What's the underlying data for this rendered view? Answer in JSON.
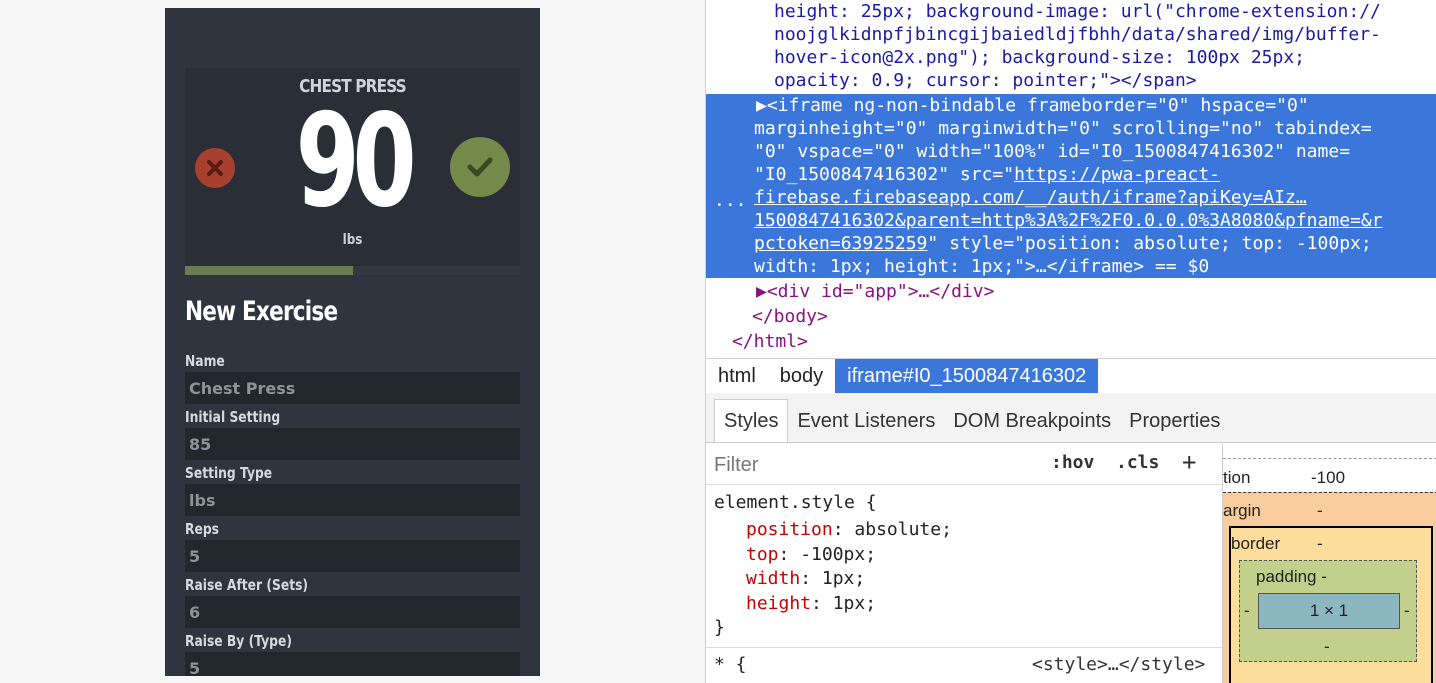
{
  "app": {
    "card": {
      "exercise": "CHEST PRESS",
      "value": "90",
      "unit": "lbs",
      "progress": 0.5,
      "colors": {
        "reject": "#a7402f",
        "accept": "#738a4a",
        "progress": "#6c7c55"
      }
    },
    "section_title": "New Exercise",
    "fields": [
      {
        "label": "Name",
        "placeholder": "Chest Press"
      },
      {
        "label": "Initial Setting",
        "placeholder": "85"
      },
      {
        "label": "Setting Type",
        "placeholder": "lbs"
      },
      {
        "label": "Reps",
        "placeholder": "5"
      },
      {
        "label": "Raise After (Sets)",
        "placeholder": "6"
      },
      {
        "label": "Raise By (Type)",
        "placeholder": "5"
      }
    ]
  },
  "devtools": {
    "code_top": [
      "height: 25px; background-image: url(\"chrome-extension://",
      "noojglkidnpfjbincgijbaiedldjfbhh/data/shared/img/buffer-",
      "hover-icon@2x.png\"); background-size: 100px 25px;",
      "opacity: 0.9; cursor: pointer;\"></span>"
    ],
    "selected": {
      "ellipsis": "...",
      "line1_open": "▶<iframe ",
      "line1_rest": "ng-non-bindable frameborder=\"0\" hspace=\"0\"",
      "line2": "marginheight=\"0\" marginwidth=\"0\" scrolling=\"no\" tabindex=",
      "line3": "\"0\" vspace=\"0\" width=\"100%\" id=\"I0_1500847416302\" name=",
      "line4a": "\"",
      "line4b": "I0_1500847416302",
      "line4c": "\" src=\"",
      "line4d": "https://pwa-preact-",
      "line5": "firebase.firebaseapp.com/__/auth/iframe?apiKey=AIz…",
      "line6": "1500847416302&parent=http%3A%2F%2F0.0.0.0%3A8080&pfname=&r",
      "line7a": "pctoken=63925259",
      "line7b": "\" style=\"position: absolute; top: -100px;",
      "line8": "width: 1px; height: 1px;\">…</iframe> == $0"
    },
    "code_bottom": [
      "▶<div id=\"app\">…</div>",
      "</body>",
      "</html>"
    ],
    "breadcrumbs": [
      "html",
      "body",
      "iframe#I0_1500847416302"
    ],
    "tabs": [
      "Styles",
      "Event Listeners",
      "DOM Breakpoints",
      "Properties"
    ],
    "filter": {
      "placeholder": "Filter",
      "hov": ":hov",
      "cls": ".cls",
      "add": "+"
    },
    "rule": {
      "selector": "element.style {",
      "props": [
        {
          "name": "position",
          "value": "absolute;"
        },
        {
          "name": "top",
          "value": "-100px;"
        },
        {
          "name": "width",
          "value": "1px;"
        },
        {
          "name": "height",
          "value": "1px;"
        }
      ],
      "close": "}",
      "next_selector": "* {",
      "next_source": "<style>…</style>"
    },
    "box_model": {
      "position_label": "tion",
      "position_value": "-100",
      "margin_label": "argin",
      "margin_value": "-",
      "border_label": "border",
      "border_value": "-",
      "padding_label": "padding -",
      "content": "1 × 1",
      "side": "-",
      "padding_bottom": "-"
    }
  }
}
